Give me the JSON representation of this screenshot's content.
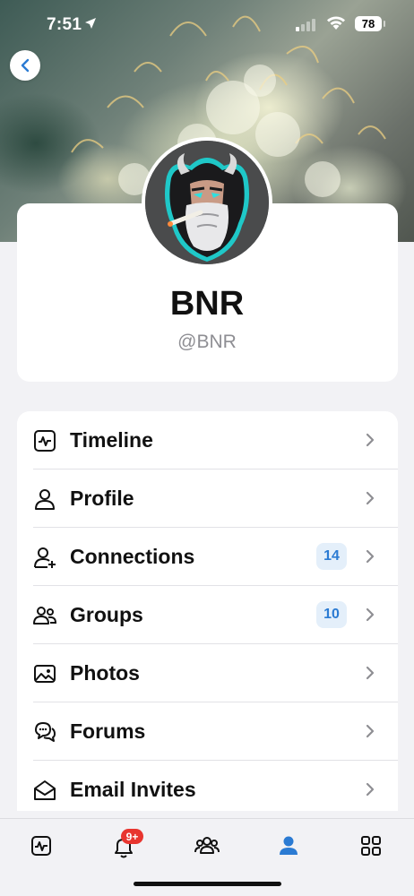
{
  "status_bar": {
    "time": "7:51",
    "battery": "78"
  },
  "profile": {
    "name": "BNR",
    "handle": "@BNR"
  },
  "menu": [
    {
      "label": "Timeline",
      "icon": "activity-icon",
      "badge": null
    },
    {
      "label": "Profile",
      "icon": "user-icon",
      "badge": null
    },
    {
      "label": "Connections",
      "icon": "user-plus-icon",
      "badge": "14"
    },
    {
      "label": "Groups",
      "icon": "users-icon",
      "badge": "10"
    },
    {
      "label": "Photos",
      "icon": "photo-icon",
      "badge": null
    },
    {
      "label": "Forums",
      "icon": "chat-bubbles-icon",
      "badge": null
    },
    {
      "label": "Email Invites",
      "icon": "envelope-open-icon",
      "badge": null
    }
  ],
  "tabbar": {
    "notifications_badge": "9+",
    "active_tab": "profile"
  },
  "colors": {
    "accent": "#2b7bd3",
    "badge_bg": "#e4effa",
    "notif": "#e8352f"
  }
}
